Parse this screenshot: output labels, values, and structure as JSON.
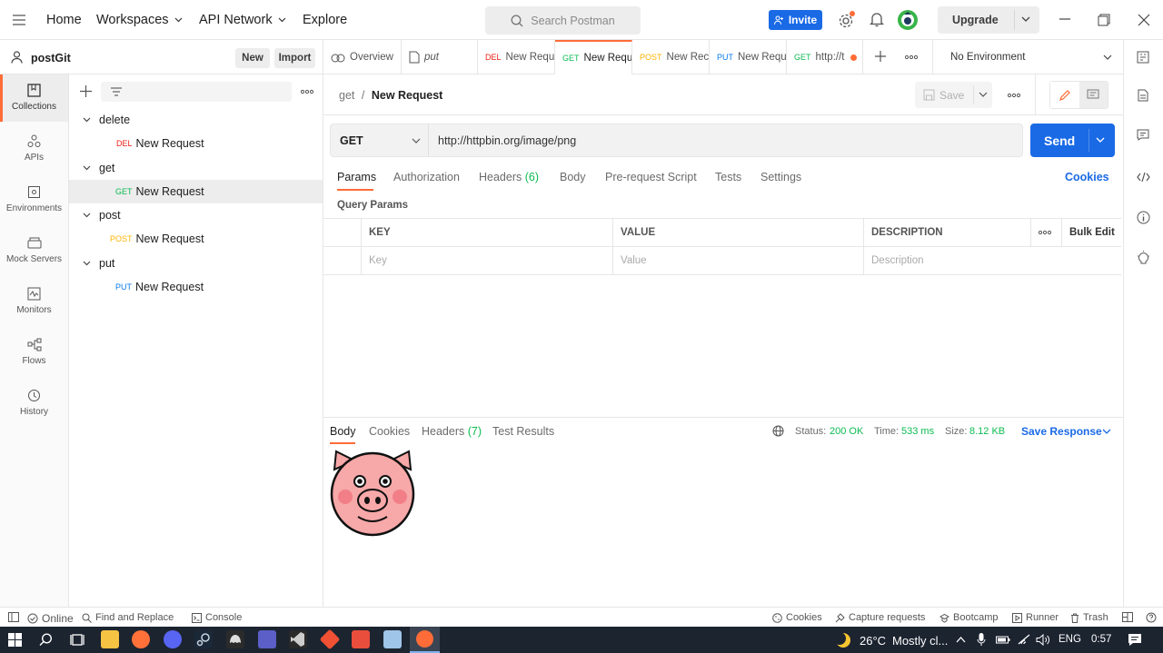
{
  "topbar": {
    "nav": [
      "Home",
      "Workspaces",
      "API Network",
      "Explore"
    ],
    "search_placeholder": "Search Postman",
    "invite_label": "Invite",
    "upgrade_label": "Upgrade",
    "icons": [
      "settings-icon",
      "bell-icon",
      "avatar-icon",
      "minimize-icon",
      "restore-icon",
      "close-icon"
    ]
  },
  "workspace": {
    "name": "postGit",
    "new_label": "New",
    "import_label": "Import"
  },
  "tabs": [
    {
      "method": "",
      "label": "Overview",
      "icon": "overview-icon"
    },
    {
      "method": "",
      "label": "put",
      "icon": "doc-icon"
    },
    {
      "method": "DEL",
      "label": "New Requ"
    },
    {
      "method": "GET",
      "label": "New Requ",
      "active": true
    },
    {
      "method": "POST",
      "label": "New Rec"
    },
    {
      "method": "PUT",
      "label": "New Requ"
    },
    {
      "method": "GET",
      "label": "http://t",
      "unsaved": true
    }
  ],
  "environment": "No Environment",
  "rail": [
    {
      "label": "Collections",
      "icon": "collections-icon",
      "active": true
    },
    {
      "label": "APIs",
      "icon": "apis-icon"
    },
    {
      "label": "Environments",
      "icon": "environments-icon"
    },
    {
      "label": "Mock Servers",
      "icon": "mock-servers-icon"
    },
    {
      "label": "Monitors",
      "icon": "monitors-icon"
    },
    {
      "label": "Flows",
      "icon": "flows-icon"
    },
    {
      "label": "History",
      "icon": "history-icon"
    }
  ],
  "tree": [
    {
      "folder": "delete",
      "method": "DEL",
      "request": "New Request"
    },
    {
      "folder": "get",
      "method": "GET",
      "request": "New Request",
      "selected": true
    },
    {
      "folder": "post",
      "method": "POST",
      "request": "New Request"
    },
    {
      "folder": "put",
      "method": "PUT",
      "request": "New Request"
    }
  ],
  "request": {
    "breadcrumb_parent": "get",
    "breadcrumb_sep": "/",
    "breadcrumb_current": "New Request",
    "save_label": "Save",
    "method": "GET",
    "url": "http://httpbin.org/image/png",
    "send_label": "Send",
    "tabs": [
      "Params",
      "Authorization",
      "Headers",
      "Body",
      "Pre-request Script",
      "Tests",
      "Settings"
    ],
    "headers_count": "(6)",
    "cookies_label": "Cookies",
    "query_params_title": "Query Params",
    "columns": [
      "KEY",
      "VALUE",
      "DESCRIPTION"
    ],
    "bulk_edit": "Bulk Edit",
    "placeholders": [
      "Key",
      "Value",
      "Description"
    ]
  },
  "response": {
    "tabs": [
      "Body",
      "Cookies",
      "Headers",
      "Test Results"
    ],
    "headers_count": "(7)",
    "status_label": "Status:",
    "status_value": "200 OK",
    "time_label": "Time:",
    "time_value": "533 ms",
    "size_label": "Size:",
    "size_value": "8.12 KB",
    "save_response": "Save Response"
  },
  "statusbar": {
    "online": "Online",
    "find_replace": "Find and Replace",
    "console": "Console",
    "cookies": "Cookies",
    "capture": "Capture requests",
    "bootcamp": "Bootcamp",
    "runner": "Runner",
    "trash": "Trash"
  },
  "taskbar": {
    "weather": "26°C",
    "weather_desc": "Mostly cl...",
    "lang": "ENG",
    "time": "0:57"
  },
  "colors": {
    "accent": "#ff6c37",
    "primary": "#1a6ae6",
    "get": "#0cbb52",
    "delete": "#eb2013",
    "post": "#ffb400",
    "put": "#097bed"
  }
}
